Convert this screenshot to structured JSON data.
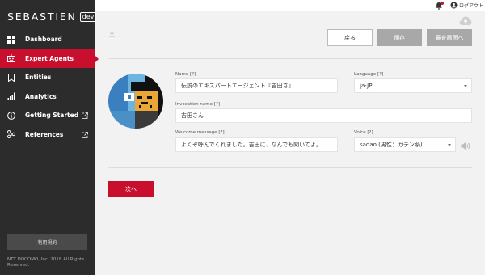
{
  "brand": {
    "name": "SEBASTIEN",
    "tag": "dev"
  },
  "sidebar": {
    "items": [
      {
        "label": "Dashboard",
        "icon": "grid-icon",
        "active": false
      },
      {
        "label": "Expert Agents",
        "icon": "robot-icon",
        "active": true
      },
      {
        "label": "Entities",
        "icon": "bookmark-icon",
        "active": false
      },
      {
        "label": "Analytics",
        "icon": "bar-chart-icon",
        "active": false
      },
      {
        "label": "Getting Started",
        "icon": "info-icon",
        "active": false,
        "external": true
      },
      {
        "label": "References",
        "icon": "nodes-icon",
        "active": false,
        "external": true
      }
    ],
    "terms_label": "利用規約",
    "copyright": "NTT DOCOMO, Inc. 2018 All Rights Reserved."
  },
  "topbar": {
    "logout_label": "ログアウト"
  },
  "toolbar": {
    "back_label": "戻る",
    "save_label": "保存",
    "review_label": "審査画面へ"
  },
  "form": {
    "name_label": "Name [?]",
    "name_value": "伝説のエキスパートエージェント『吉田さ』",
    "language_label": "Language [?]",
    "language_value": "ja-JP",
    "invocation_label": "Invocation name [?]",
    "invocation_value": "吉田さん",
    "welcome_label": "Welcome message [?]",
    "welcome_value": "よくぞ呼んでくれました。吉田に、なんでも聞いてよ。",
    "voice_label": "Voice [?]",
    "voice_value": "sadao (男性：ガテン系)"
  },
  "next_label": "次へ",
  "colors": {
    "accent": "#c8102e",
    "sidebar_bg": "#2c2c2c",
    "disabled_btn": "#a8a8a8"
  }
}
